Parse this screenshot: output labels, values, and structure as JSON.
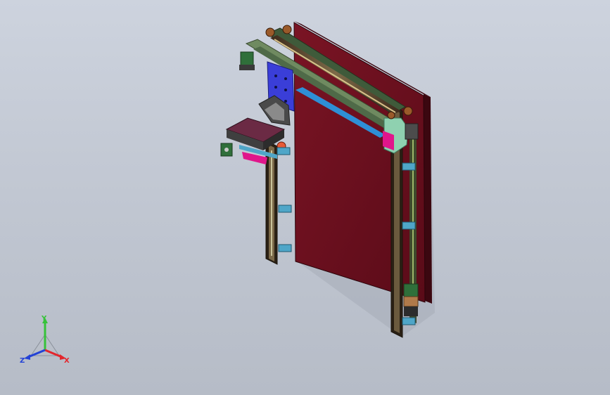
{
  "viewport": {
    "background_top": "#cdd3de",
    "background_bottom": "#b6bcc7"
  },
  "model": {
    "panel_color": "#6e0f1e",
    "frame_color": "#5f7a54",
    "bracket_color": "#4fa6c8",
    "motor_color": "#2f6f3a",
    "plate_color": "#3a3ed8",
    "carriage_top_color": "#6b2a44",
    "accent_color": "#e0168b",
    "bracket_light_color": "#8fd1b0"
  },
  "triad": {
    "x_label": "X",
    "y_label": "Y",
    "z_label": "Z",
    "x_color": "#e3262d",
    "y_color": "#36c23a",
    "z_color": "#2342d6"
  }
}
